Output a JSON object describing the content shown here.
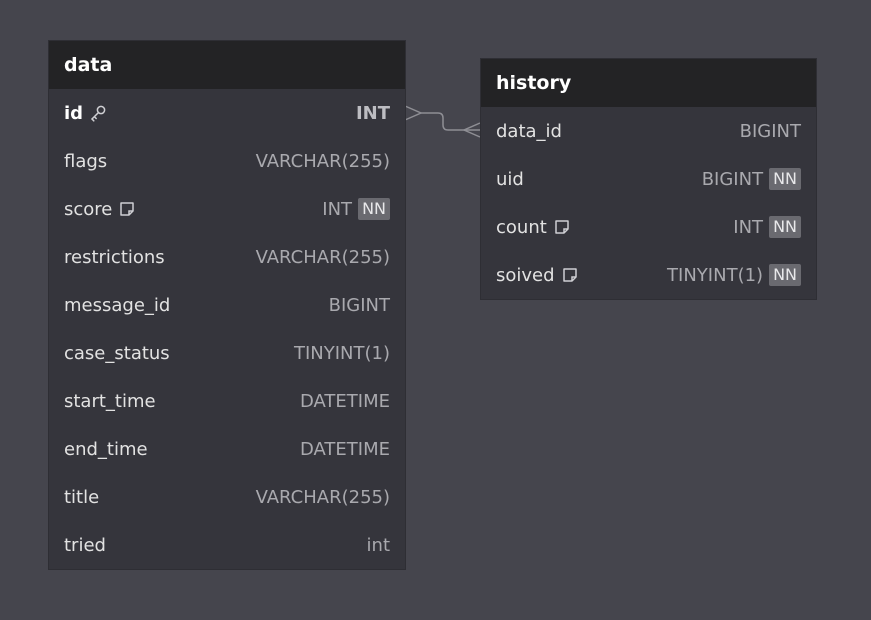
{
  "tables": [
    {
      "name": "data",
      "columns": [
        {
          "name": "id",
          "type": "INT",
          "pk": true
        },
        {
          "name": "flags",
          "type": "VARCHAR(255)"
        },
        {
          "name": "score",
          "type": "INT",
          "nn": "NN",
          "note": true
        },
        {
          "name": "restrictions",
          "type": "VARCHAR(255)"
        },
        {
          "name": "message_id",
          "type": "BIGINT"
        },
        {
          "name": "case_status",
          "type": "TINYINT(1)"
        },
        {
          "name": "start_time",
          "type": "DATETIME"
        },
        {
          "name": "end_time",
          "type": "DATETIME"
        },
        {
          "name": "title",
          "type": "VARCHAR(255)"
        },
        {
          "name": "tried",
          "type": "int"
        }
      ]
    },
    {
      "name": "history",
      "columns": [
        {
          "name": "data_id",
          "type": "BIGINT"
        },
        {
          "name": "uid",
          "type": "BIGINT",
          "nn": "NN"
        },
        {
          "name": "count",
          "type": "INT",
          "nn": "NN",
          "note": true
        },
        {
          "name": "soived",
          "type": "TINYINT(1)",
          "nn": "NN",
          "note": true
        }
      ]
    }
  ],
  "relationship": {
    "from": "data.id",
    "to": "history.data_id",
    "type": "one-to-many"
  },
  "colors": {
    "background": "#45454d",
    "header": "#232325",
    "body": "#35353c",
    "connector": "#8e8e94"
  }
}
